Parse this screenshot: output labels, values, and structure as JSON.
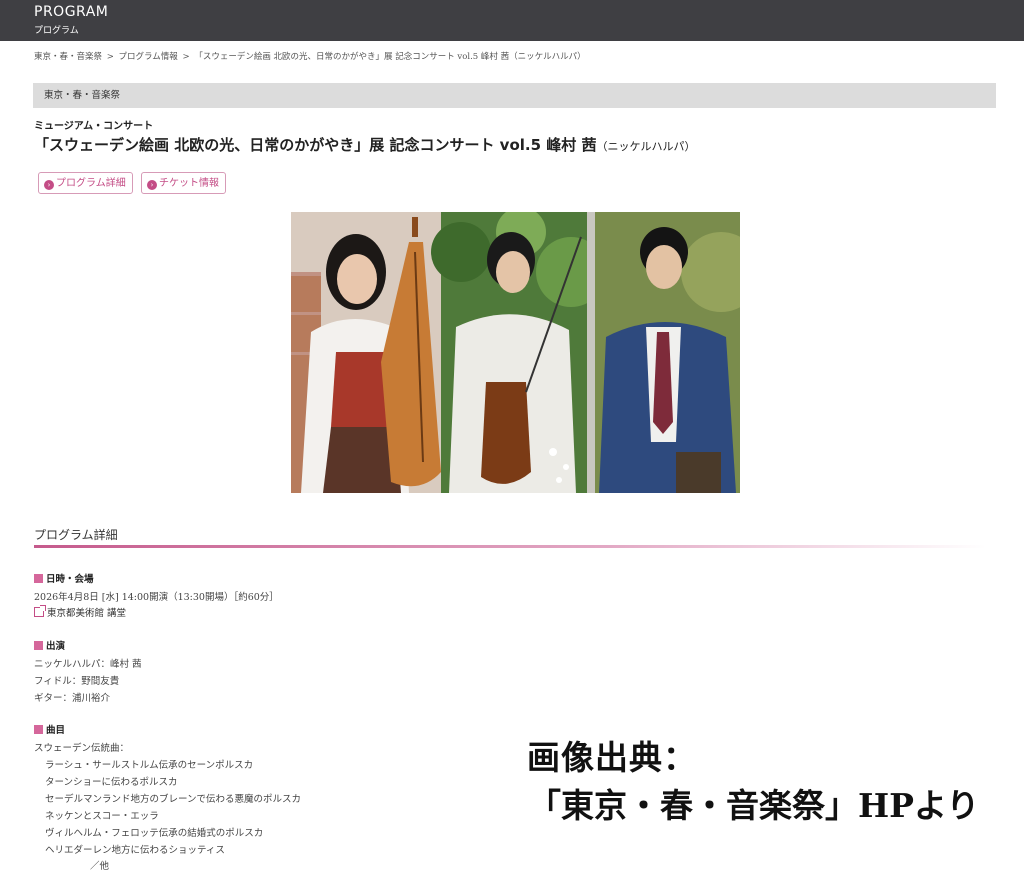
{
  "header": {
    "title": "PROGRAM",
    "subtitle": "プログラム"
  },
  "breadcrumb": [
    "東京・春・音楽祭",
    "プログラム情報",
    "「スウェーデン絵画 北欧の光、日常のかがやき」展 記念コンサート vol.5 峰村 茜（ニッケルハルパ）"
  ],
  "breadcrumb_sep": ">",
  "festival_bar": "東京・春・音楽祭",
  "program": {
    "category": "ミュージアム・コンサート",
    "title": "「スウェーデン絵画 北欧の光、日常のかがやき」展 記念コンサート vol.5 峰村 茜",
    "title_sub": "（ニッケルハルパ）",
    "buttons": {
      "detail": "プログラム詳細",
      "ticket": "チケット情報"
    }
  },
  "details": {
    "heading": "プログラム詳細",
    "date_label": "日時・会場",
    "date_value": "2026年4月8日 [水] 14:00開演（13:30開場）［約60分］",
    "venue": "東京都美術館 講堂",
    "performers_label": "出演",
    "performers": [
      "ニッケルハルパ：峰村 茜",
      "フィドル：野間友貴",
      "ギター：浦川裕介"
    ],
    "program_label": "曲目",
    "program_intro": "スウェーデン伝統曲：",
    "pieces": [
      "ラーシュ・サールストルム伝承のセーンポルスカ",
      "ターンショーに伝わるポルスカ",
      "セーデルマンランド地方のブレーンで伝わる悪魔のポルスカ",
      "ネッケンとスコー・エッラ",
      "ヴィルヘルム・フェロッテ伝承の結婚式のポルスカ",
      "ヘリエダーレン地方に伝わるショッティス"
    ],
    "pieces_more": "／他"
  },
  "overlay": {
    "line1": "画像出典：",
    "line2": "「東京・春・音楽祭」HPより"
  },
  "colors": {
    "accent": "#c44d86",
    "topbar": "#3f3f43",
    "festbar": "#dcdcdc"
  }
}
